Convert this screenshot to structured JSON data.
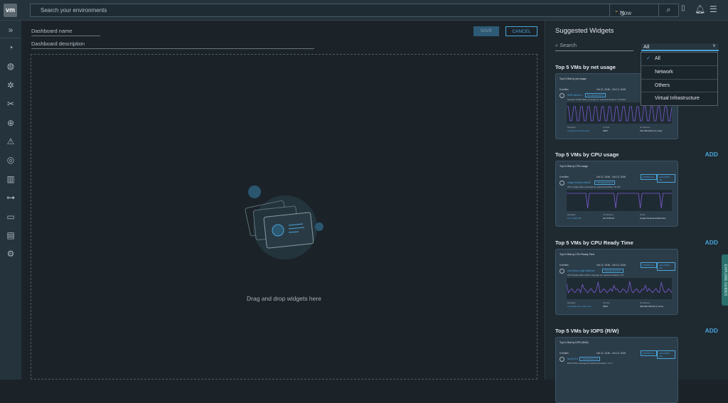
{
  "topbar": {
    "logo": "vm",
    "search_placeholder": "Search your environments",
    "time": "Now",
    "time_icon": "clock-icon"
  },
  "sidebar": {
    "items": [
      "expand",
      "dashboards",
      "environment",
      "applications",
      "tools",
      "troubleshoot",
      "alerts",
      "network",
      "metrics",
      "inventory",
      "monitor",
      "reports",
      "settings"
    ]
  },
  "editor": {
    "name_placeholder": "Dashboard name",
    "description_placeholder": "Dashboard description",
    "save": "SAVE",
    "cancel": "CANCEL",
    "drop_text": "Drag and drop widgets here"
  },
  "panel": {
    "title": "Suggested Widgets",
    "search_placeholder": "Search",
    "filter_value": "All",
    "filter_options": [
      "All",
      "Network",
      "Others",
      "Virtual Infrastructure"
    ],
    "add": "ADD",
    "explore": "EXPLORE GUIDES"
  },
  "widgets": [
    {
      "title": "Top 5 VMs by net usage",
      "card_title": "Top 5 VMs by net usage",
      "entries": "5 entities",
      "dates": "Oct 12, 15:46  -  Oct 13, 15:46",
      "expand": "EXPAND ALL",
      "collapse": "COLLAPSE ALL",
      "vm": "IPeR-Server-1",
      "troubleshoot": "TROUBLESHOOT",
      "metric": "Network Traffic Rate | Average for selected duration: 3.6 Gbps",
      "f1_label": "Manager",
      "f1_value": "sc-pbs-vmt.ember.local",
      "f2_label": "VLANs",
      "f2_value": "2005",
      "f3_label": "IP Address",
      "f3_value": "192.168.100.9 (1 more)"
    },
    {
      "title": "Top 5 VMs by CPU usage",
      "card_title": "Top 5 VMs by CPU usage",
      "entries": "5 entities",
      "dates": "Oct 12, 15:46  -  Oct 13, 15:46",
      "expand": "EXPAND ALL",
      "collapse": "COLLAPSE ALL",
      "vm": "image-frontend-web02",
      "troubleshoot": "TROUBLESHOOT",
      "metric": "CPU Usage Rate | Average for selected duration: 97.3%",
      "f1_label": "Manager",
      "f1_value": "10.72.185.196",
      "f2_label": "IP Address",
      "f2_value": "10.72.83.32",
      "f3_label": "Disks",
      "f3_value": "image-frontend-web02-Har..."
    },
    {
      "title": "Top 5 VMs by CPU Ready Time",
      "card_title": "Top 5 VMs by CPU Ready Time",
      "entries": "5 entities",
      "dates": "Oct 12, 15:46  -  Oct 13, 15:46",
      "expand": "EXPAND ALL",
      "collapse": "COLLAPSE ALL",
      "vm": "vrni-nsxuni-edge-billsbone",
      "troubleshoot": "TROUBLESHOOT",
      "metric": "CPU Ready Rate vCPU | Average for selected duration: 2%",
      "f1_label": "Manager",
      "f1_value": "sc-hybrid-vms.cmbu.corp",
      "f2_label": "VLANs",
      "f2_value": "3500",
      "f3_label": "IP Address",
      "f3_value": "200.200.160.35 (1 more)"
    },
    {
      "title": "Top 5 VMs by IOPS (R/W)",
      "card_title": "Top 5 VMs by IOPS (R/W)",
      "entries": "5 entities",
      "dates": "Oct 12, 15:46  -  Oct 13, 15:46",
      "expand": "EXPAND ALL",
      "collapse": "COLLAPSE ALL",
      "vm": "icm-8-014",
      "troubleshoot": "TROUBLESHOOT",
      "metric": "R/W IOPS | Average for selected duration: 4.2 k",
      "f1_label": "",
      "f1_value": "",
      "f2_label": "",
      "f2_value": "",
      "f3_label": "",
      "f3_value": ""
    }
  ],
  "colors": {
    "accent": "#4aa3d8",
    "chart_line": "#7b5cd6",
    "now": "#e6c338"
  }
}
